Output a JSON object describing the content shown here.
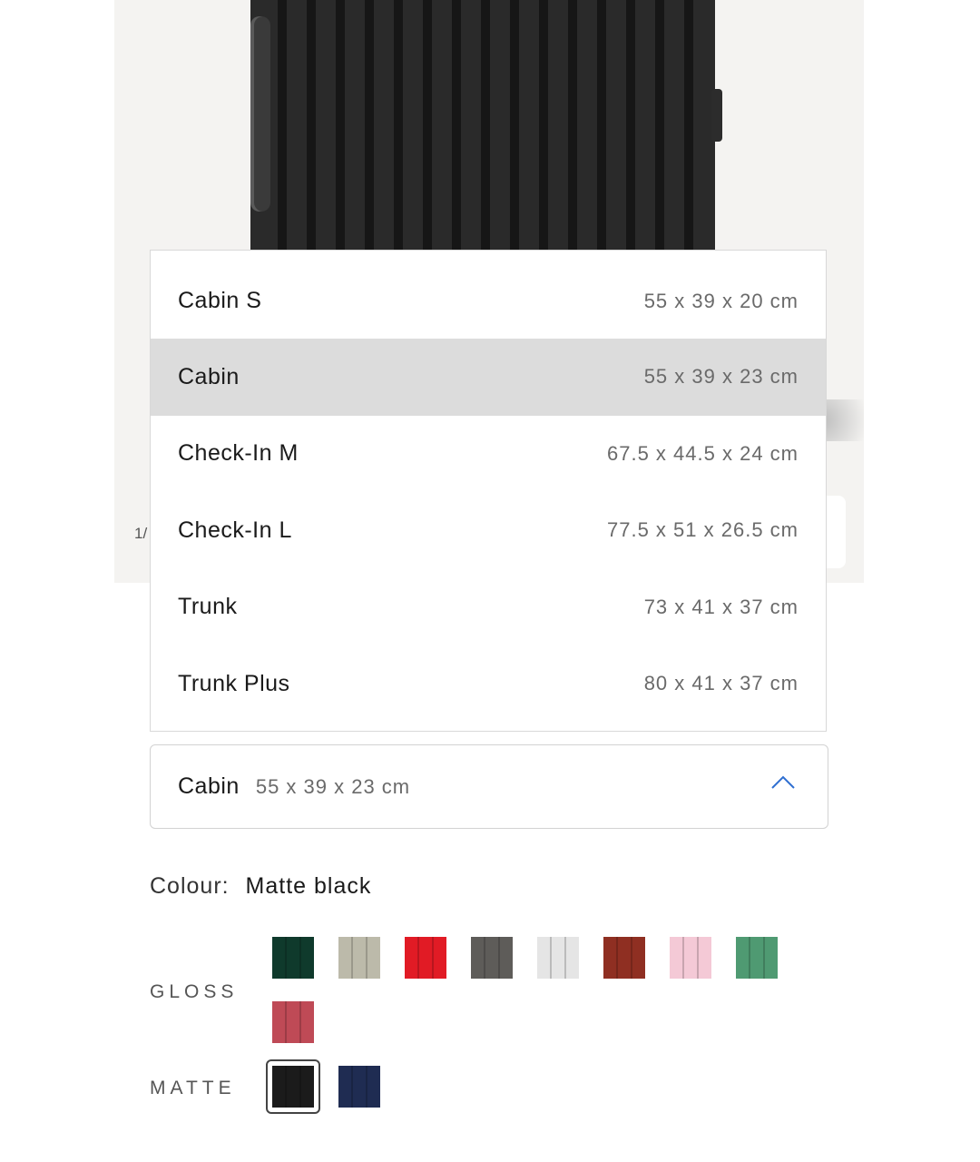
{
  "hero": {
    "image_counter": "1/"
  },
  "size_dropdown": {
    "options": [
      {
        "name": "Cabin S",
        "dims": "55 x 39 x 20 cm"
      },
      {
        "name": "Cabin",
        "dims": "55 x 39 x 23 cm"
      },
      {
        "name": "Check-In M",
        "dims": "67.5 x 44.5 x 24 cm"
      },
      {
        "name": "Check-In L",
        "dims": "77.5 x 51 x 26.5 cm"
      },
      {
        "name": "Trunk",
        "dims": "73 x 41 x 37 cm"
      },
      {
        "name": "Trunk Plus",
        "dims": "80 x 41 x 37 cm"
      }
    ],
    "selected_index": 1,
    "selected_value": "Cabin",
    "selected_dims": "55 x 39 x 23 cm",
    "state": "expanded",
    "chevron_icon": "chevron-up-icon",
    "chevron_color": "#2f6fd1"
  },
  "colour": {
    "label": "Colour:",
    "selected": "Matte black",
    "gloss_label": "GLOSS",
    "matte_label": "MATTE",
    "gloss_swatches": [
      "#0f3a2c",
      "#bcbaaa",
      "#e11b25",
      "#5e5c59",
      "#e5e5e5",
      "#8f2f22",
      "#f4c9d6",
      "#4f9a72",
      "#bf4a56"
    ],
    "matte_swatches": [
      "#1b1b1b",
      "#1f2c52"
    ],
    "selected_swatch": "matte-0"
  }
}
